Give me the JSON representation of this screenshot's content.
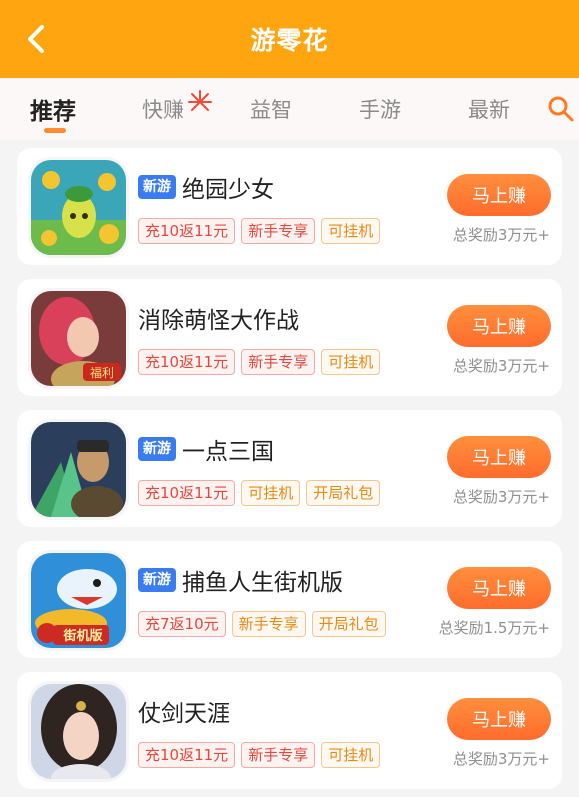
{
  "header": {
    "title": "游零花"
  },
  "tabs": [
    {
      "label": "推荐",
      "active": true
    },
    {
      "label": "快赚",
      "active": false
    },
    {
      "label": "益智",
      "active": false
    },
    {
      "label": "手游",
      "active": false
    },
    {
      "label": "最新",
      "active": false
    }
  ],
  "accent_color": "#ffa50f",
  "games": [
    {
      "name": "绝园少女",
      "is_new": true,
      "new_label": "新游",
      "tags": [
        "充10返11元",
        "新手专享",
        "可挂机"
      ],
      "button": "马上赚",
      "reward": "总奖励3万元+",
      "icon": "flower-sprite-icon"
    },
    {
      "name": "消除萌怪大作战",
      "is_new": false,
      "new_label": "",
      "tags": [
        "充10返11元",
        "新手专享",
        "可挂机"
      ],
      "button": "马上赚",
      "reward": "总奖励3万元+",
      "icon": "elf-girl-icon",
      "icon_text": "福利"
    },
    {
      "name": "一点三国",
      "is_new": true,
      "new_label": "新游",
      "tags": [
        "充10返11元",
        "可挂机",
        "开局礼包"
      ],
      "button": "马上赚",
      "reward": "总奖励3万元+",
      "icon": "warrior-icon"
    },
    {
      "name": "捕鱼人生街机版",
      "is_new": true,
      "new_label": "新游",
      "tags": [
        "充7返10元",
        "新手专享",
        "开局礼包"
      ],
      "button": "马上赚",
      "reward": "总奖励1.5万元+",
      "icon": "fish-arcade-icon",
      "icon_text": "街机版"
    },
    {
      "name": "仗剑天涯",
      "is_new": false,
      "new_label": "",
      "tags": [
        "充10返11元",
        "新手专享",
        "可挂机"
      ],
      "button": "马上赚",
      "reward": "总奖励3万元+",
      "icon": "swordswoman-icon"
    }
  ]
}
